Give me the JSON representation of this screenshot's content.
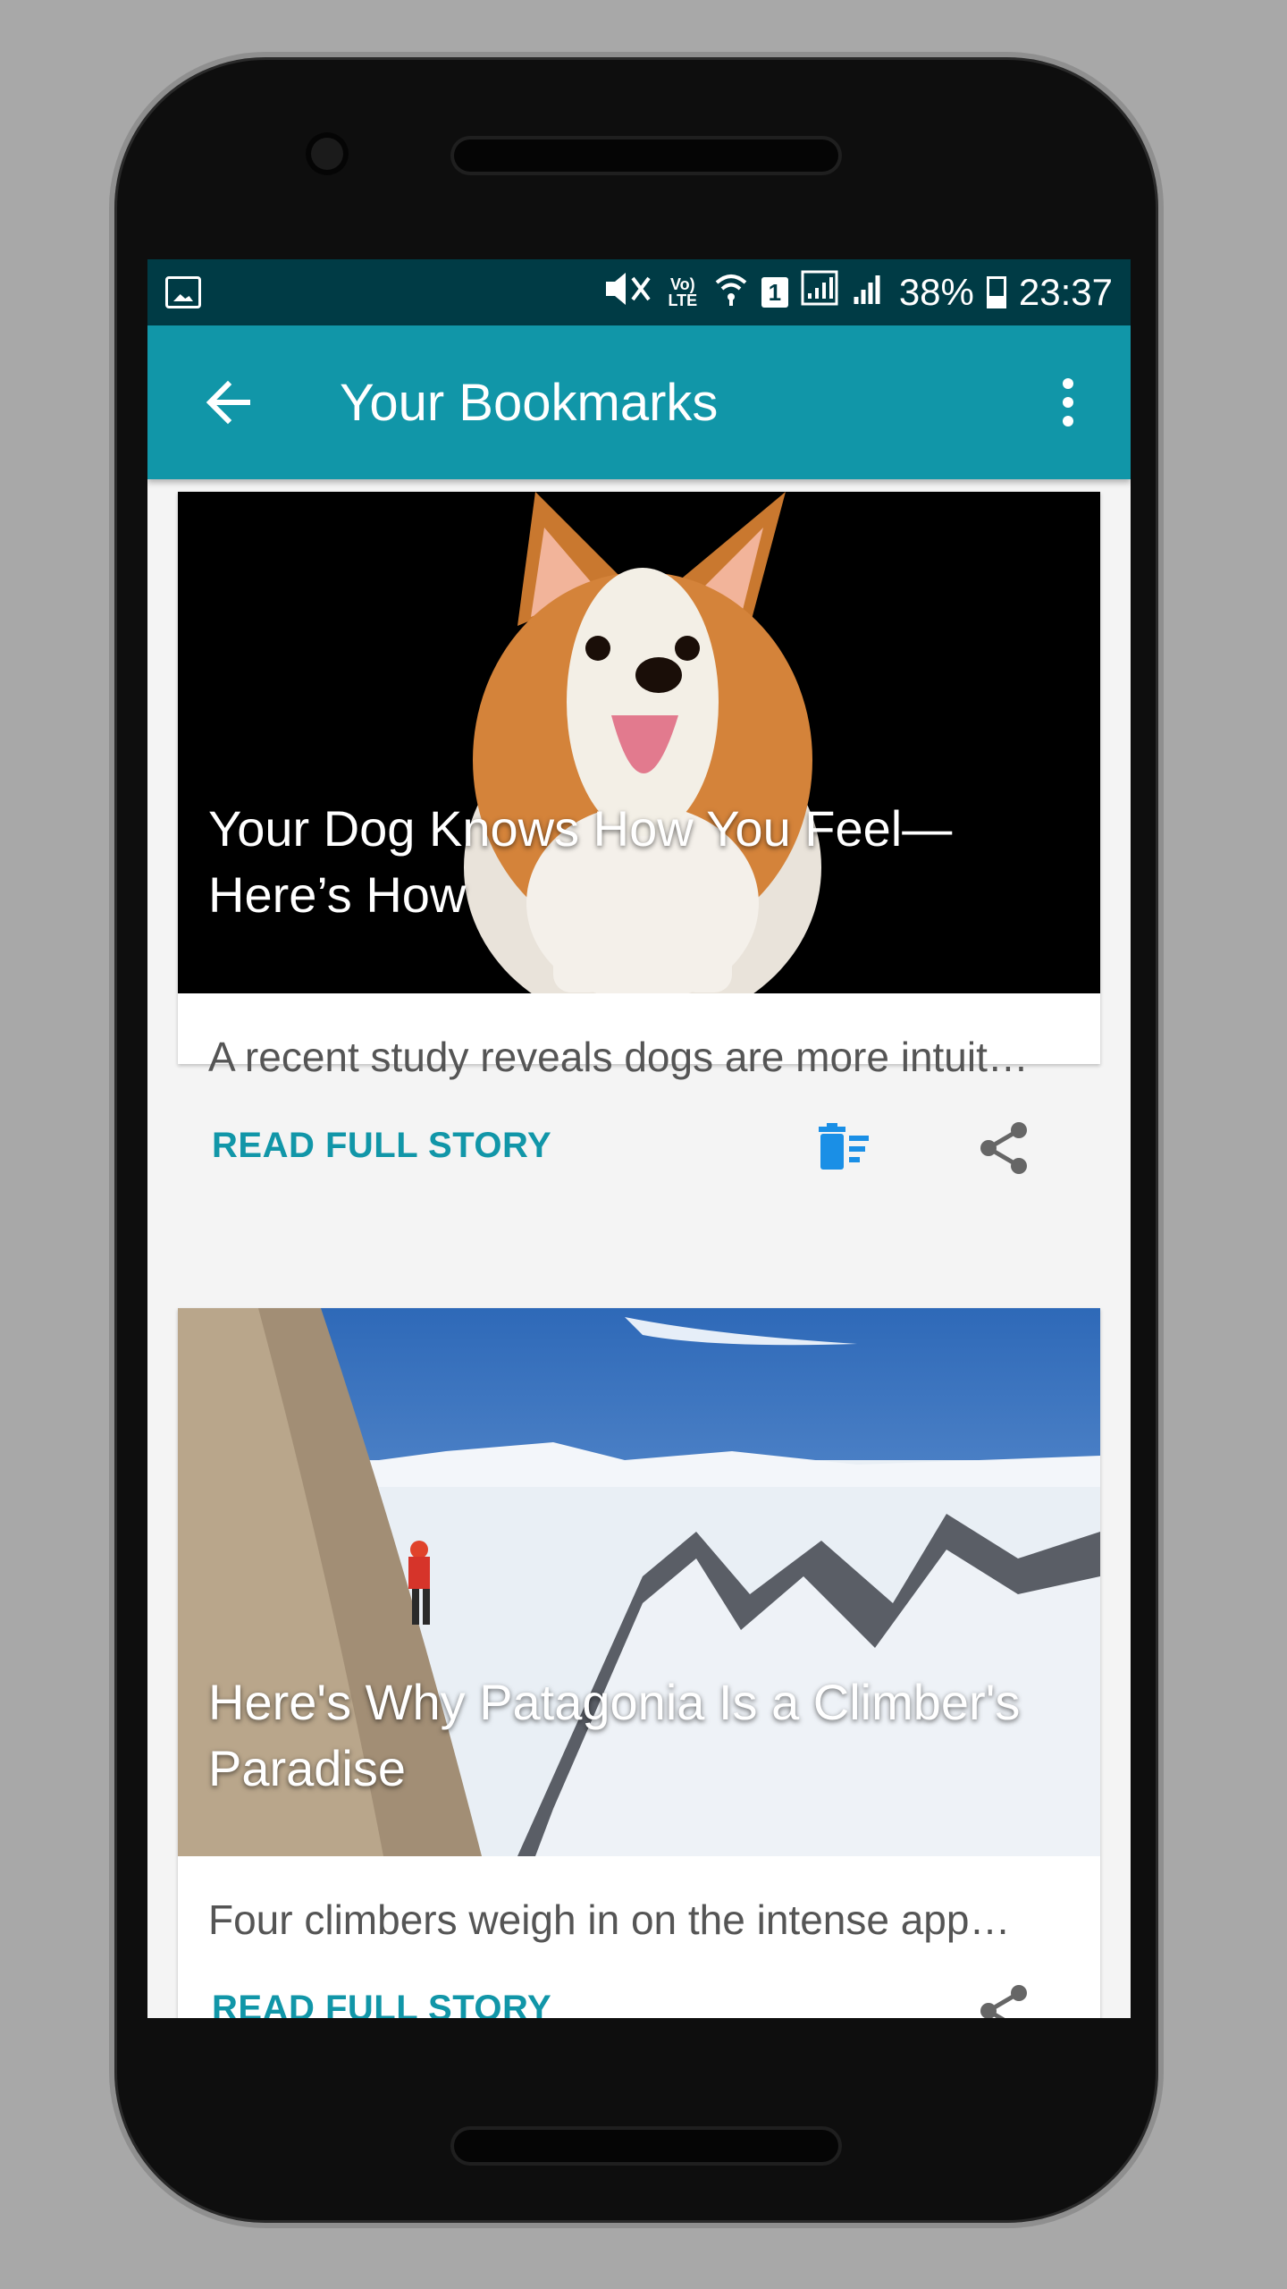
{
  "statusbar": {
    "battery_percent": "38%",
    "time": "23:37",
    "sim_label": "1",
    "volte_label": "Vo) LTE",
    "icons": [
      "image-icon",
      "mute-vibrate-icon",
      "volte-icon",
      "wifi-icon",
      "sim-icon",
      "signal-icon",
      "battery-icon"
    ]
  },
  "appbar": {
    "title": "Your Bookmarks",
    "back_icon": "arrow-left-icon",
    "menu_icon": "more-vert-icon",
    "color": "#1196a8"
  },
  "cards": [
    {
      "title": "Your Dog Knows How You Feel—Here’s How",
      "description": "A recent study reveals dogs are more intuit…",
      "read_label": "READ FULL STORY",
      "delete_icon": "delete-bookmark-icon",
      "share_icon": "share-icon"
    },
    {
      "title": "Here's Why Patagonia Is a Climber's Paradise",
      "description": "Four climbers weigh in on the intense app…",
      "read_label": "READ FULL STORY",
      "share_icon": "share-icon"
    }
  ],
  "colors": {
    "status_bar": "#003b45",
    "accent": "#1196a8",
    "delete_icon": "#1a8fe6",
    "text_secondary": "#555555"
  }
}
